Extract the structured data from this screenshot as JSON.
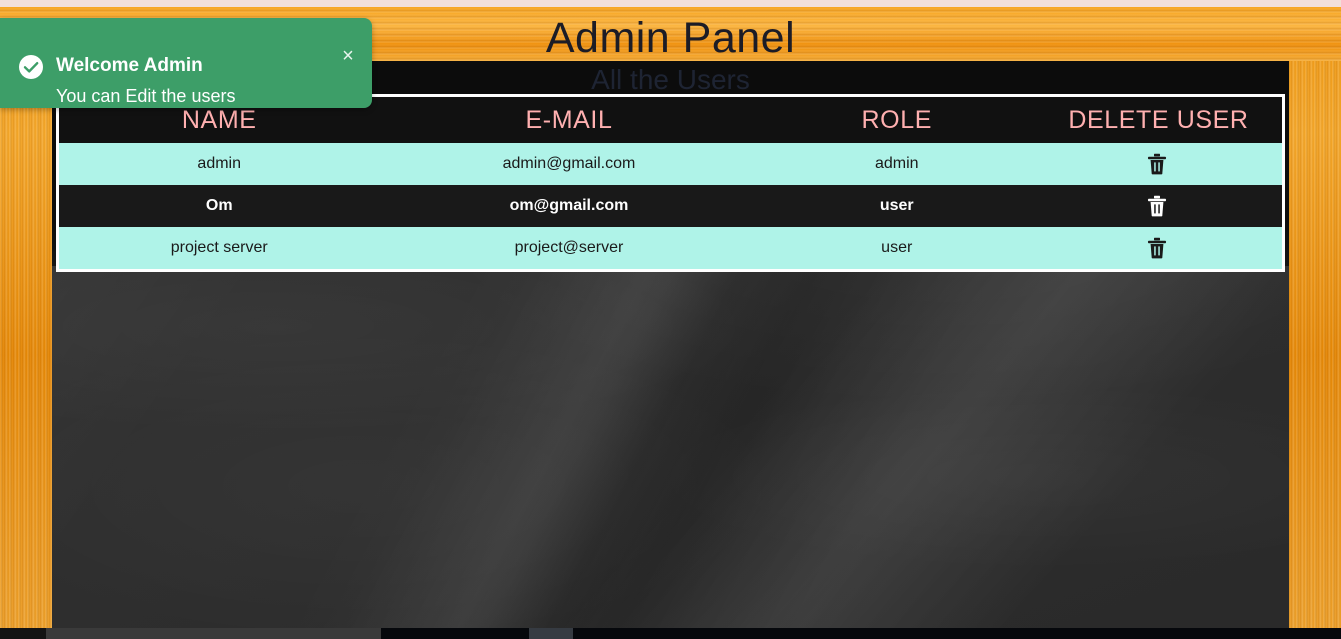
{
  "page": {
    "title": "Admin Panel",
    "subtitle": "All the Users"
  },
  "toast": {
    "icon": "check-circle-icon",
    "title": "Welcome Admin",
    "message": "You can Edit the users",
    "close_label": "×",
    "background_color": "#3d9e68",
    "text_color": "#ffffff"
  },
  "table": {
    "headers": {
      "name": "NAME",
      "email": "E-MAIL",
      "role": "ROLE",
      "delete": "DELETE USER"
    },
    "header_text_color": "#ffb0b0",
    "header_background": "#111111",
    "row_light_background": "#aff3e8",
    "row_dark_background": "#191919",
    "border_color": "#ffffff",
    "delete_icon": "trash-icon",
    "rows": [
      {
        "name": "admin",
        "email": "admin@gmail.com",
        "role": "admin",
        "style": "light"
      },
      {
        "name": "Om",
        "email": "om@gmail.com",
        "role": "user",
        "style": "dark"
      },
      {
        "name": "project server",
        "email": "project@server",
        "role": "user",
        "style": "light"
      }
    ]
  },
  "theme": {
    "frame_color": "#f39a12",
    "board_color": "#2c2c2c",
    "top_strip_color": "#f2e0da"
  }
}
